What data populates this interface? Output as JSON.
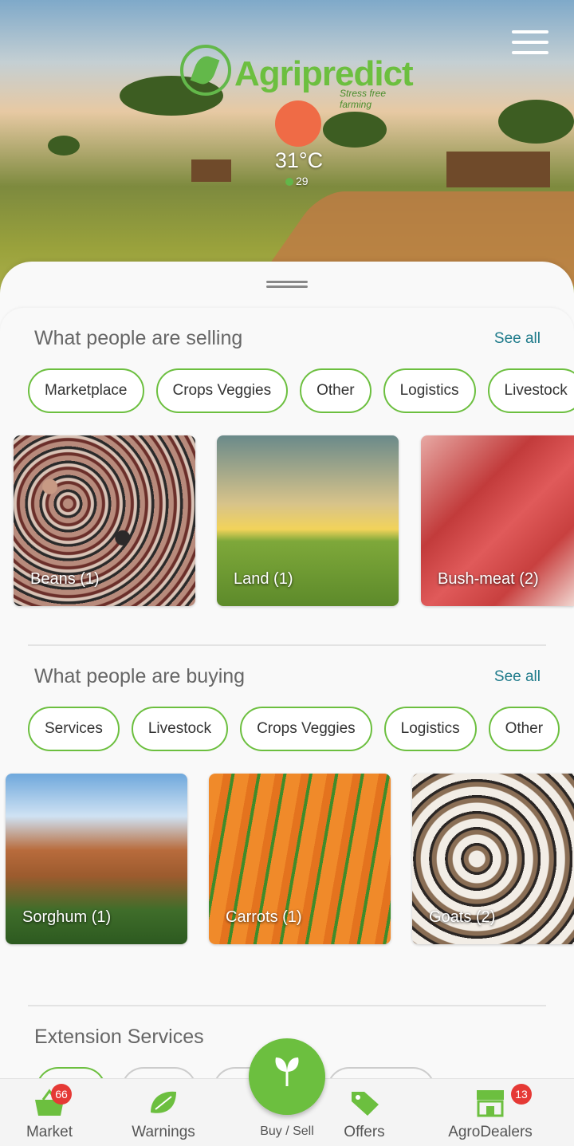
{
  "colors": {
    "accent": "#6cbf3f",
    "link": "#1d7a8a",
    "badge": "#e53935"
  },
  "hero": {
    "brand": "Agripredict",
    "tagline": "Stress free farming",
    "temperature": "31°C",
    "location_count": "29"
  },
  "selling": {
    "title": "What people are selling",
    "see_all": "See all",
    "chips": [
      "Marketplace",
      "Crops Veggies",
      "Other",
      "Logistics",
      "Livestock"
    ],
    "cards": [
      {
        "label": "Beans (1)",
        "image": "beans"
      },
      {
        "label": "Land (1)",
        "image": "land"
      },
      {
        "label": "Bush-meat (2)",
        "image": "meat"
      }
    ]
  },
  "buying": {
    "title": "What people are buying",
    "see_all": "See all",
    "chips": [
      "Services",
      "Livestock",
      "Crops Veggies",
      "Logistics",
      "Other"
    ],
    "cards": [
      {
        "label": "Sorghum (1)",
        "image": "sorghum"
      },
      {
        "label": "Carrots (1)",
        "image": "carrots"
      },
      {
        "label": "Goats (2)",
        "image": "goats"
      }
    ]
  },
  "extension": {
    "title": "Extension Services"
  },
  "nav": {
    "market": {
      "label": "Market",
      "badge": "66",
      "icon": "basket-icon"
    },
    "warnings": {
      "label": "Warnings",
      "icon": "leaf-warning-icon"
    },
    "buy_sell": {
      "label": "Buy / Sell",
      "icon": "plant-icon"
    },
    "offers": {
      "label": "Offers",
      "icon": "tag-icon"
    },
    "agrodealers": {
      "label": "AgroDealers",
      "badge": "13",
      "icon": "shop-icon"
    }
  }
}
